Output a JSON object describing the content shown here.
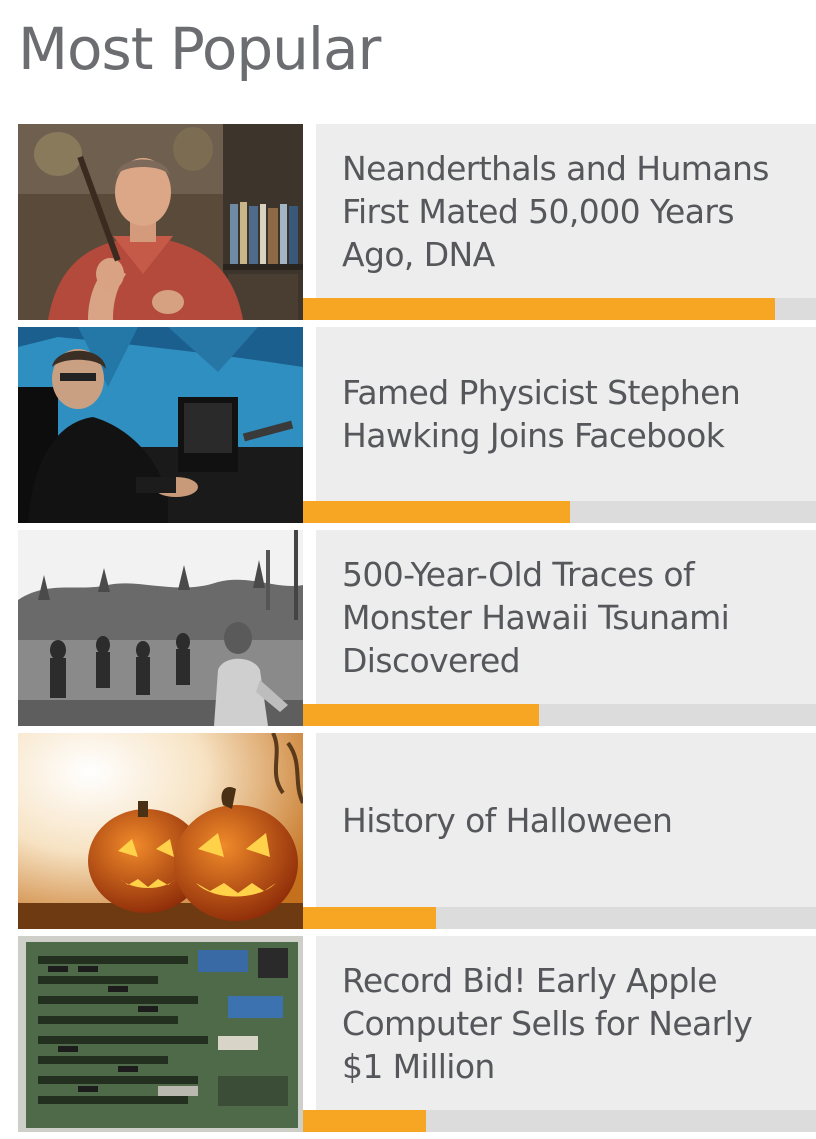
{
  "widget": {
    "title": "Most Popular"
  },
  "colors": {
    "accent_bar": "#f6a623",
    "bar_track": "#dcdcdd",
    "panel_bg": "#ededee",
    "title_text": "#6b6d70",
    "headline_text": "#55575a"
  },
  "articles": [
    {
      "headline": "Neanderthals and Humans First Mated 50,000 Years Ago, DNA",
      "thumbnail": "scientist-portrait-thumbnail",
      "popularity": 0.92
    },
    {
      "headline": "Famed Physicist Stephen Hawking Joins Facebook",
      "thumbnail": "physicist-wheelchair-thumbnail",
      "popularity": 0.52
    },
    {
      "headline": "500-Year-Old Traces of Monster Hawaii Tsunami Discovered",
      "thumbnail": "tsunami-crowd-thumbnail",
      "popularity": 0.46
    },
    {
      "headline": "History of Halloween",
      "thumbnail": "jack-o-lantern-thumbnail",
      "popularity": 0.26
    },
    {
      "headline": "Record Bid! Early Apple Computer Sells for Nearly $1 Million",
      "thumbnail": "circuit-board-thumbnail",
      "popularity": 0.24
    }
  ]
}
